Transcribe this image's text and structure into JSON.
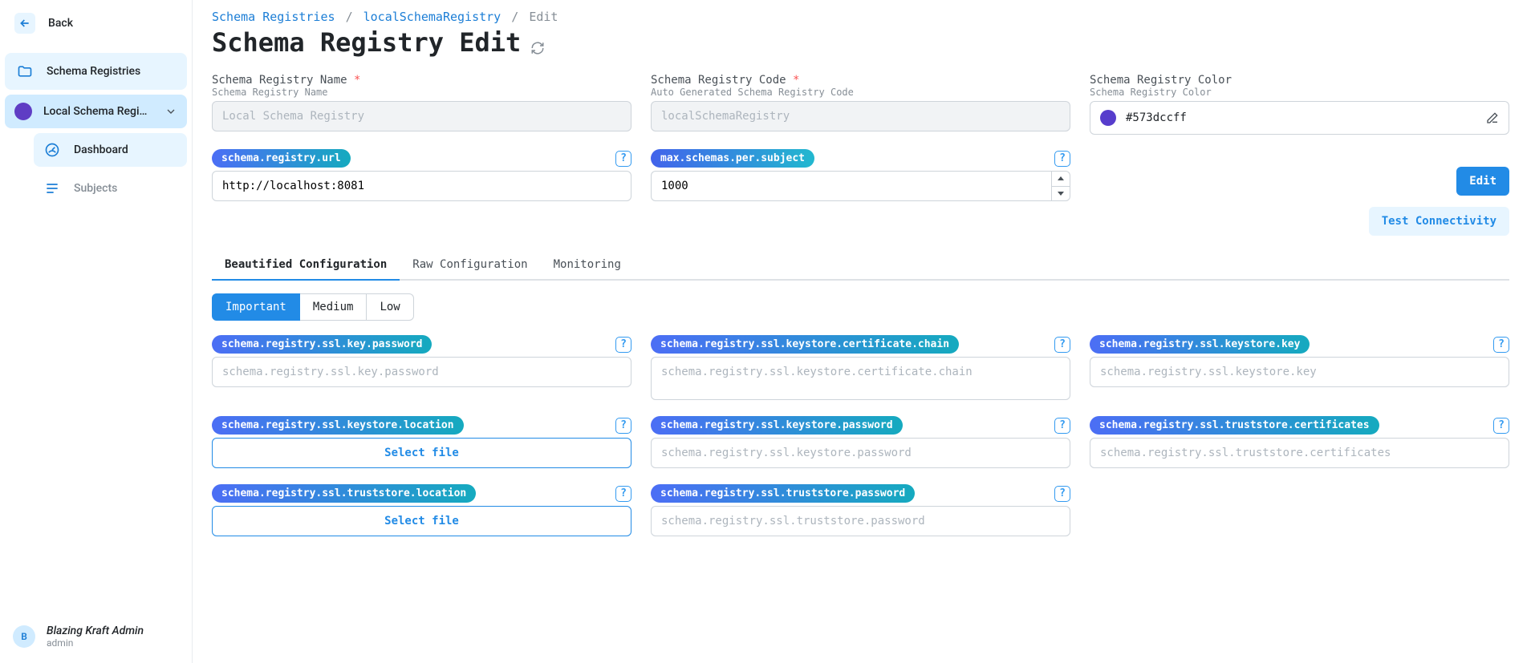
{
  "sidebar": {
    "back_label": "Back",
    "schema_registries_label": "Schema Registries",
    "local_label": "Local Schema Regi…",
    "dashboard_label": "Dashboard",
    "subjects_label": "Subjects",
    "user_name": "Blazing Kraft Admin",
    "user_sub": "admin",
    "avatar_initial": "B"
  },
  "breadcrumb": {
    "a": "Schema Registries",
    "b": "localSchemaRegistry",
    "c": "Edit"
  },
  "page_title": "Schema Registry Edit",
  "fields": {
    "name_label": "Schema Registry Name",
    "name_help": "Schema Registry Name",
    "name_value": "Local Schema Registry",
    "code_label": "Schema Registry Code",
    "code_help": "Auto Generated Schema Registry Code",
    "code_value": "localSchemaRegistry",
    "color_label": "Schema Registry Color",
    "color_help": "Schema Registry Color",
    "color_value": "#573dccff",
    "color_swatch": "#573dcc",
    "url_pill": "schema.registry.url",
    "url_value": "http://localhost:8081",
    "max_pill": "max.schemas.per.subject",
    "max_value": "1000",
    "edit_btn": "Edit",
    "test_btn": "Test Connectivity"
  },
  "tabs": {
    "a": "Beautified Configuration",
    "b": "Raw Configuration",
    "c": "Monitoring"
  },
  "importance": {
    "a": "Important",
    "b": "Medium",
    "c": "Low"
  },
  "cfg": [
    {
      "key": "schema.registry.ssl.key.password",
      "ph": "schema.registry.ssl.key.password",
      "type": "text"
    },
    {
      "key": "schema.registry.ssl.keystore.certificate.chain",
      "ph": "schema.registry.ssl.keystore.certificate.chain",
      "type": "textarea"
    },
    {
      "key": "schema.registry.ssl.keystore.key",
      "ph": "schema.registry.ssl.keystore.key",
      "type": "text"
    },
    {
      "key": "schema.registry.ssl.keystore.location",
      "ph": "Select file",
      "type": "file"
    },
    {
      "key": "schema.registry.ssl.keystore.password",
      "ph": "schema.registry.ssl.keystore.password",
      "type": "text"
    },
    {
      "key": "schema.registry.ssl.truststore.certificates",
      "ph": "schema.registry.ssl.truststore.certificates",
      "type": "text"
    },
    {
      "key": "schema.registry.ssl.truststore.location",
      "ph": "Select file",
      "type": "file"
    },
    {
      "key": "schema.registry.ssl.truststore.password",
      "ph": "schema.registry.ssl.truststore.password",
      "type": "text"
    }
  ]
}
